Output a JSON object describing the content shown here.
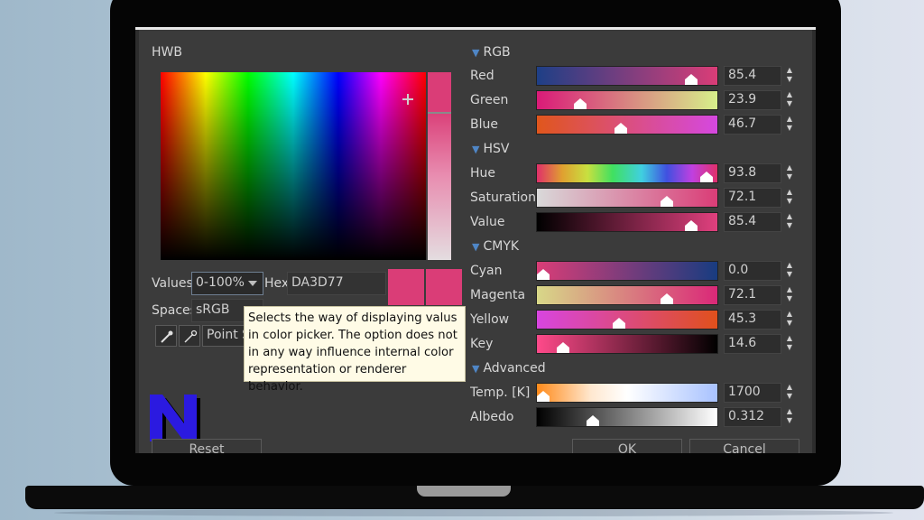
{
  "left_panel": {
    "title": "HWB",
    "values_label": "Values",
    "values_selected": "0-100%",
    "hex_label": "Hex",
    "hex_value": "DA3D77",
    "spaces_label": "Spaces",
    "spaces_value": "sRGB",
    "point_button_label": "Point S",
    "swatch_color": "#da3d77"
  },
  "tooltip": {
    "text": "Selects the way of displaying valus\nin color picker. The option does not\nin any way influence internal color\nrepresentation or renderer behavior."
  },
  "logo": {
    "letter": "N",
    "color": "#2b1ae0"
  },
  "buttons": {
    "reset": "Reset",
    "ok": "OK",
    "cancel": "Cancel"
  },
  "sections": {
    "rgb": {
      "title": "RGB",
      "rows": [
        {
          "label": "Red",
          "value": "85.4",
          "fraction": 0.854
        },
        {
          "label": "Green",
          "value": "23.9",
          "fraction": 0.239
        },
        {
          "label": "Blue",
          "value": "46.7",
          "fraction": 0.467
        }
      ]
    },
    "hsv": {
      "title": "HSV",
      "rows": [
        {
          "label": "Hue",
          "value": "93.8",
          "fraction": 0.938
        },
        {
          "label": "Saturation",
          "value": "72.1",
          "fraction": 0.721
        },
        {
          "label": "Value",
          "value": "85.4",
          "fraction": 0.854
        }
      ]
    },
    "cmyk": {
      "title": "CMYK",
      "rows": [
        {
          "label": "Cyan",
          "value": "0.0",
          "fraction": 0.0
        },
        {
          "label": "Magenta",
          "value": "72.1",
          "fraction": 0.721
        },
        {
          "label": "Yellow",
          "value": "45.3",
          "fraction": 0.453
        },
        {
          "label": "Key",
          "value": "14.6",
          "fraction": 0.146
        }
      ]
    },
    "advanced": {
      "title": "Advanced",
      "rows": [
        {
          "label": "Temp. [K]",
          "value": "1700",
          "fraction": 0.0
        },
        {
          "label": "Albedo",
          "value": "0.312",
          "fraction": 0.312
        }
      ]
    }
  }
}
